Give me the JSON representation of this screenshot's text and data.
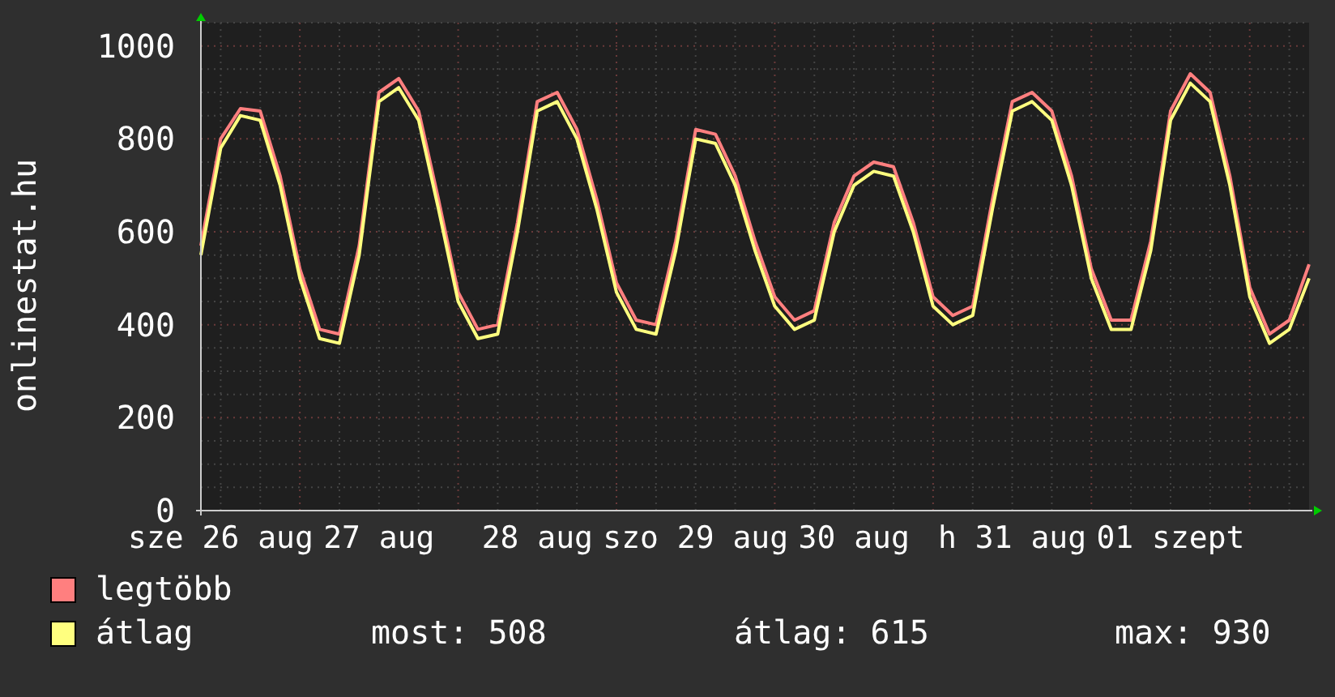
{
  "chart": {
    "chart_data": {
      "type": "line",
      "grid": true,
      "ylabel": "onlinestat.hu",
      "ylim": [
        0,
        1050
      ],
      "yticks": [
        0,
        200,
        400,
        600,
        800,
        1000
      ],
      "categories": [
        null,
        "sze 26 aug",
        null,
        null,
        null,
        null,
        null,
        null,
        null,
        "27 aug",
        null,
        null,
        null,
        null,
        null,
        null,
        null,
        "28 aug",
        null,
        null,
        null,
        null,
        null,
        null,
        null,
        "szo 29 aug",
        null,
        null,
        null,
        null,
        null,
        null,
        null,
        "30 aug",
        null,
        null,
        null,
        null,
        null,
        null,
        null,
        "h 31 aug",
        null,
        null,
        null,
        null,
        null,
        null,
        null,
        "01 szept",
        null,
        null,
        null,
        null,
        null,
        null,
        null
      ],
      "series": [
        {
          "name": "legtöbb",
          "color": "#ff7f7f",
          "values": [
            570,
            800,
            865,
            860,
            720,
            520,
            390,
            380,
            570,
            900,
            930,
            860,
            670,
            470,
            390,
            400,
            620,
            880,
            900,
            820,
            670,
            490,
            410,
            400,
            580,
            820,
            810,
            720,
            580,
            460,
            410,
            430,
            620,
            720,
            750,
            740,
            620,
            460,
            420,
            440,
            670,
            880,
            900,
            860,
            720,
            520,
            410,
            410,
            580,
            860,
            940,
            900,
            720,
            480,
            380,
            410,
            530
          ]
        },
        {
          "name": "átlag",
          "color": "#ffff7f",
          "values": [
            550,
            780,
            850,
            840,
            700,
            500,
            370,
            360,
            550,
            880,
            910,
            840,
            650,
            450,
            370,
            380,
            600,
            860,
            880,
            800,
            650,
            470,
            390,
            380,
            560,
            800,
            790,
            700,
            560,
            440,
            390,
            410,
            600,
            700,
            730,
            720,
            600,
            440,
            400,
            420,
            650,
            860,
            880,
            840,
            700,
            500,
            390,
            390,
            560,
            840,
            920,
            880,
            700,
            460,
            360,
            390,
            500
          ]
        }
      ]
    }
  },
  "legend": {
    "stats": [
      "most: 508",
      "átlag: 615",
      "max: 930"
    ]
  }
}
